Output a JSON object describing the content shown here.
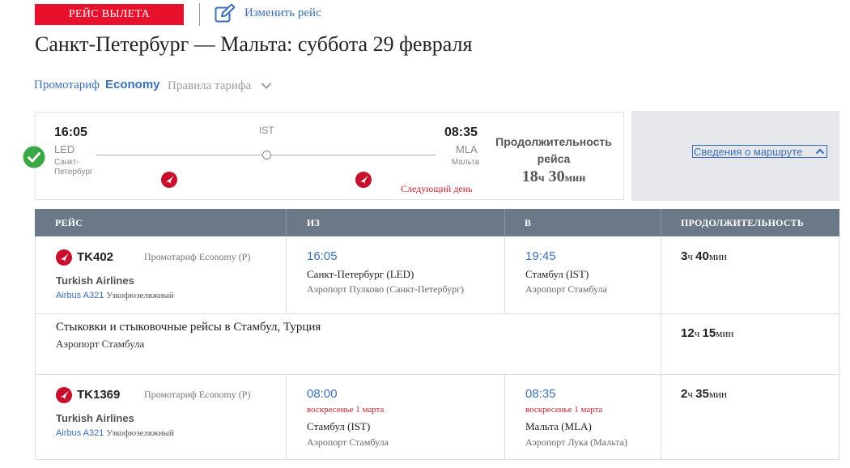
{
  "header": {
    "badge": "РЕЙС ВЫЛЕТА",
    "edit_link": "Изменить рейс",
    "title": "Санкт-Петербург — Мальта: суббота 29 февраля"
  },
  "tariff": {
    "label": "Промотариф",
    "class": "Economy",
    "rules": "Правила тарифа"
  },
  "summary": {
    "departure": {
      "time": "16:05",
      "code": "LED",
      "city": "Санкт-Петербург"
    },
    "arrival": {
      "time": "08:35",
      "code": "MLA",
      "city": "Мальта"
    },
    "stop": "IST",
    "next_day": "Следующий день",
    "duration_label": "Продолжительность рейса",
    "duration_hours": "18",
    "duration_h_unit": "ч",
    "duration_minutes": "30",
    "duration_m_unit": "мин",
    "route_link": "Сведения о маршруте"
  },
  "table": {
    "headers": [
      "РЕЙС",
      "ИЗ",
      "В",
      "ПРОДОЛЖИТЕЛЬНОСТЬ"
    ],
    "segments": [
      {
        "flight": "TK402",
        "fare": "Промотариф Economy (P)",
        "airline": "Turkish Airlines",
        "aircraft": "Airbus A321",
        "aircraft_type": "Узкофюзеляжный",
        "from_time": "16:05",
        "from_city": "Санкт-Петербург (LED)",
        "from_airport": "Аэропорт Пулково (Санкт-Петербург)",
        "to_time": "19:45",
        "to_city": "Стамбул (IST)",
        "to_airport": "Аэропорт Стамбула",
        "dur_h": "3",
        "dur_m": "40"
      },
      {
        "flight": "TK1369",
        "fare": "Промотариф Economy (P)",
        "airline": "Turkish Airlines",
        "aircraft": "Airbus A321",
        "aircraft_type": "Узкофюзеляжный",
        "from_time": "08:00",
        "from_date": "воскресенье 1 марта",
        "from_city": "Стамбул (IST)",
        "from_airport": "Аэропорт Стамбула",
        "to_time": "08:35",
        "to_date": "воскресенье 1 марта",
        "to_city": "Мальта (MLA)",
        "to_airport": "Аэропорт Лука (Мальта)",
        "dur_h": "2",
        "dur_m": "35"
      }
    ],
    "connection": {
      "title": "Стыковки и стыковочные рейсы в Стамбул, Турция",
      "airport": "Аэропорт Стамбула",
      "dur_h": "12",
      "dur_m": "15"
    },
    "h_unit": "ч",
    "m_unit": "мин"
  },
  "icons": {
    "edit": "edit-icon",
    "check": "check-circle-icon",
    "airline_logo": "turkish-airlines-logo-icon",
    "chevron_down": "chevron-down-icon",
    "chevron_up": "chevron-up-icon"
  },
  "colors": {
    "badge_red": "#e8112d",
    "link_blue": "#3b6fb8",
    "success_green": "#3aa845",
    "table_header": "#6b7887",
    "alert_red": "#cc2233"
  }
}
